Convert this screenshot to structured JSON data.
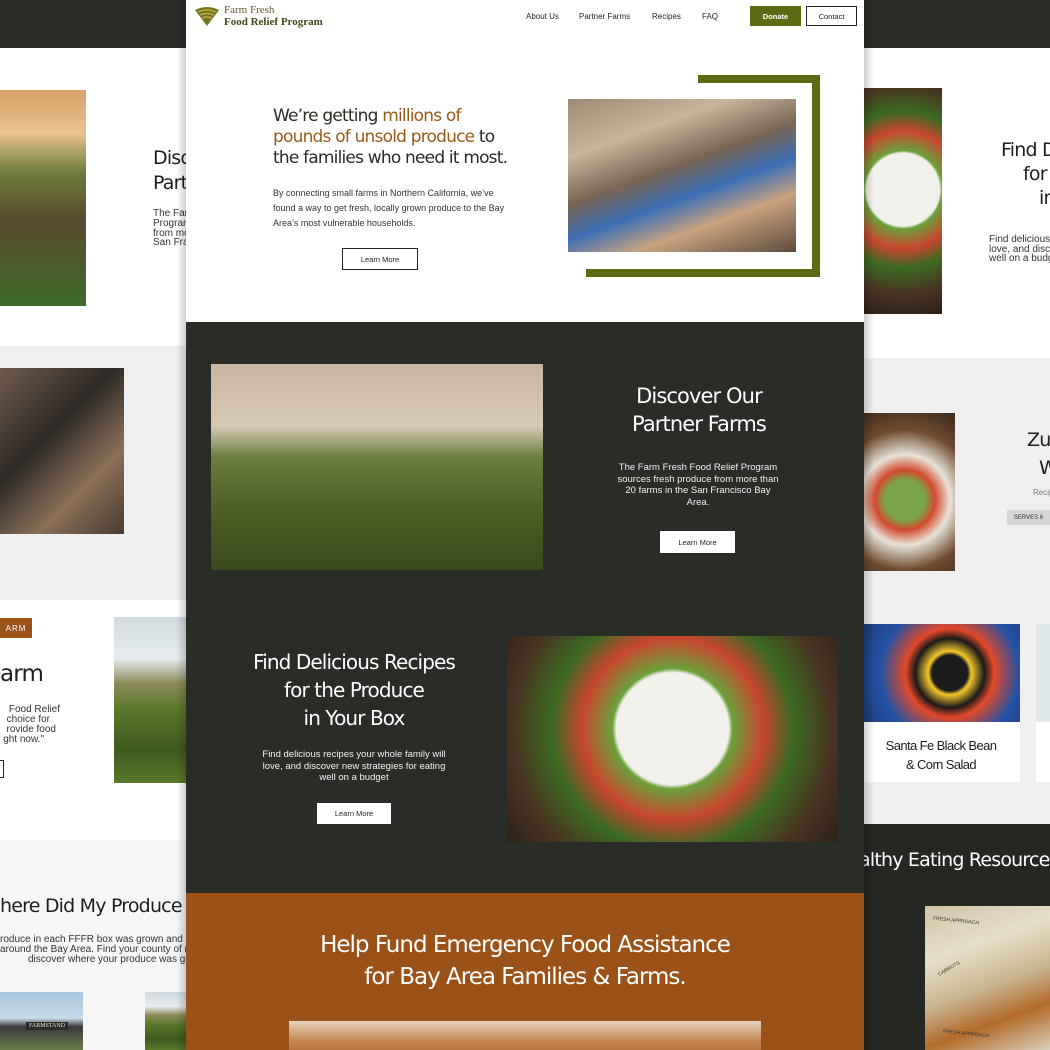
{
  "brand": {
    "line1": "Farm Fresh",
    "line2": "Food Relief Program",
    "colors": {
      "olive": "#5a6b12",
      "rust": "#9b5219",
      "charcoal": "#2a2c28"
    }
  },
  "nav": {
    "links": [
      "About Us",
      "Partner Farms",
      "Recipes",
      "FAQ"
    ],
    "donate_label": "Donate",
    "contact_label": "Contact"
  },
  "hero": {
    "headline_pre": "We’re getting ",
    "headline_highlight": "millions of pounds of unsold produce",
    "headline_post": " to the families who need it most.",
    "body": "By connecting small farms in Northern California, we’ve found a way to get fresh, locally grown produce to the Bay Area’s most vulnerable households.",
    "cta_label": "Learn More"
  },
  "partner_farms": {
    "title_line1": "Discover Our",
    "title_line2": "Partner Farms",
    "body": "The Farm Fresh Food Relief Program sources fresh produce from more than 20 farms in the San Francisco Bay Area.",
    "cta_label": "Learn More"
  },
  "recipes": {
    "title_line1": "Find Delicious Recipes",
    "title_line2": "for the Produce",
    "title_line3": "in Your Box",
    "body": "Find delicious recipes your whole family will love, and discover new strategies for eating well on a budget",
    "cta_label": "Learn More"
  },
  "fund": {
    "title_line1": "Help Fund Emergency Food Assistance",
    "title_line2": "for Bay Area Families & Farms."
  },
  "left_panels": {
    "farms_head_1": "Disco",
    "farms_head_2": "Part",
    "farms_body": [
      "The Far",
      "Program",
      "from mo",
      "San Fra"
    ],
    "farm_tag": "ARM",
    "farm_head": "arm",
    "farm_body": [
      "Food Relief",
      "choice for",
      "rovide food",
      "ght now.\""
    ],
    "produce_head": "here Did My Produce Come",
    "produce_body": [
      "roduce in each FFFR box was grown and harv",
      "around the Bay Area. Find your county of res",
      "discover where your produce was gro"
    ],
    "stand_sign": "FARMSTAND"
  },
  "right_panels": {
    "recipes_head_1": "Find De",
    "recipes_head_2": "for",
    "recipes_head_3": "in",
    "recipes_body": [
      "Find delicious",
      "love, and discov",
      "well on a budge"
    ],
    "zuc_head_1": "Zuc",
    "zuc_head_2": "W",
    "zuc_body": "Recip",
    "serves_badge": "SERVES 6",
    "card_title_1": "Santa Fe Black Bean",
    "card_title_2": "& Corn Salad",
    "resources_head": "althy Eating Resources",
    "bag_labels": [
      "FRESH APPROACH",
      "CARROTS",
      "FRESH APPROACH"
    ]
  }
}
